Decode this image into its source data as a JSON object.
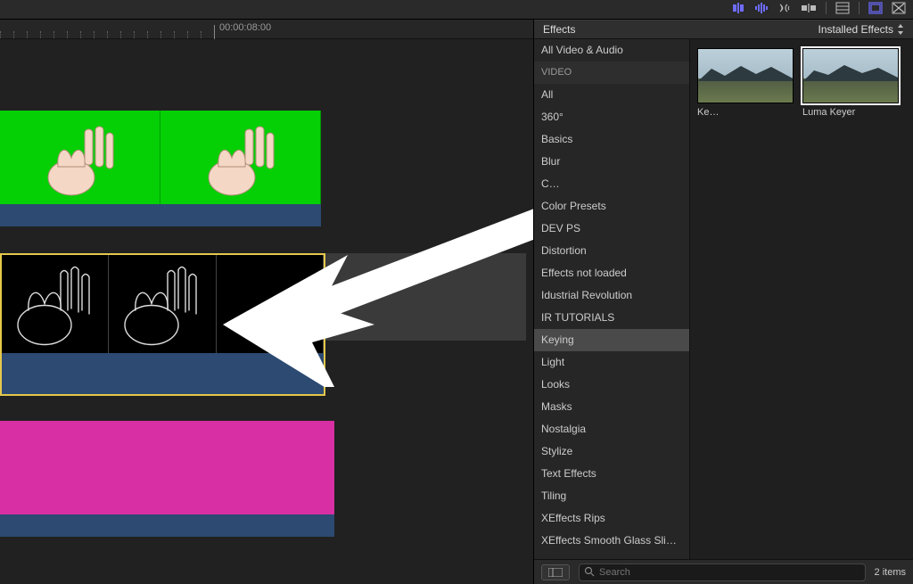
{
  "toolbar": {
    "icons": [
      "skimming",
      "audio-skim",
      "solo",
      "snapping",
      "index",
      "effects-browser",
      "transitions-browser"
    ]
  },
  "timeline": {
    "timecode": "00:00:08:00"
  },
  "effects": {
    "title": "Effects",
    "installed_label": "Installed Effects",
    "categories": [
      {
        "label": "All Video & Audio",
        "type": "item"
      },
      {
        "label": "VIDEO",
        "type": "header"
      },
      {
        "label": "All",
        "type": "item"
      },
      {
        "label": "360°",
        "type": "item"
      },
      {
        "label": "Basics",
        "type": "item"
      },
      {
        "label": "Blur",
        "type": "item"
      },
      {
        "label": "C…",
        "type": "item"
      },
      {
        "label": "Color Presets",
        "type": "item"
      },
      {
        "label": "DEV PS",
        "type": "item"
      },
      {
        "label": "Distortion",
        "type": "item"
      },
      {
        "label": "Effects not loaded",
        "type": "item"
      },
      {
        "label": "Idustrial Revolution",
        "type": "item"
      },
      {
        "label": "IR TUTORIALS",
        "type": "item"
      },
      {
        "label": "Keying",
        "type": "item",
        "selected": true
      },
      {
        "label": "Light",
        "type": "item"
      },
      {
        "label": "Looks",
        "type": "item"
      },
      {
        "label": "Masks",
        "type": "item"
      },
      {
        "label": "Nostalgia",
        "type": "item"
      },
      {
        "label": "Stylize",
        "type": "item"
      },
      {
        "label": "Text Effects",
        "type": "item"
      },
      {
        "label": "Tiling",
        "type": "item"
      },
      {
        "label": "XEffects Rips",
        "type": "item"
      },
      {
        "label": "XEffects Smooth Glass Slid…",
        "type": "item"
      }
    ],
    "thumbnails": [
      {
        "label": "Ke…",
        "selected": false
      },
      {
        "label": "Luma Keyer",
        "selected": true
      }
    ],
    "search_placeholder": "Search",
    "item_count": "2 items"
  },
  "colors": {
    "greenscreen": "#05d005",
    "magenta": "#d82fa4",
    "clip_base": "#2c4a72",
    "selection": "#e5c84a",
    "accent": "#6d6cff"
  }
}
